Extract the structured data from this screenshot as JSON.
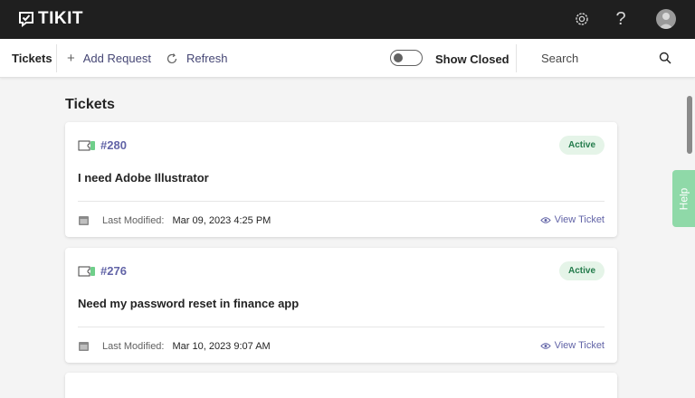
{
  "app": {
    "name": "TIKIT"
  },
  "topbar": {
    "icons": [
      "gear-icon",
      "help-icon",
      "avatar"
    ],
    "help_glyph": "?"
  },
  "commandbar": {
    "nav_label": "Tickets",
    "add_request": "Add Request",
    "refresh": "Refresh",
    "show_closed": "Show Closed",
    "show_closed_on": false,
    "search_placeholder": "Search"
  },
  "main": {
    "title": "Tickets",
    "tickets": [
      {
        "id": "#280",
        "status": "Active",
        "title": "I need Adobe Illustrator",
        "modified_label": "Last Modified:",
        "modified": "Mar 09, 2023 4:25 PM",
        "view_label": "View Ticket"
      },
      {
        "id": "#276",
        "status": "Active",
        "title": "Need my password reset in finance app",
        "modified_label": "Last Modified:",
        "modified": "Mar 10, 2023 9:07 AM",
        "view_label": "View Ticket"
      }
    ]
  },
  "help_tab": "Help",
  "colors": {
    "accent": "#6264a7",
    "active_bg": "#e5f4e8",
    "active_text": "#237b4b",
    "help_tab": "#8fd9a8",
    "topbar": "#1f1f1f"
  }
}
